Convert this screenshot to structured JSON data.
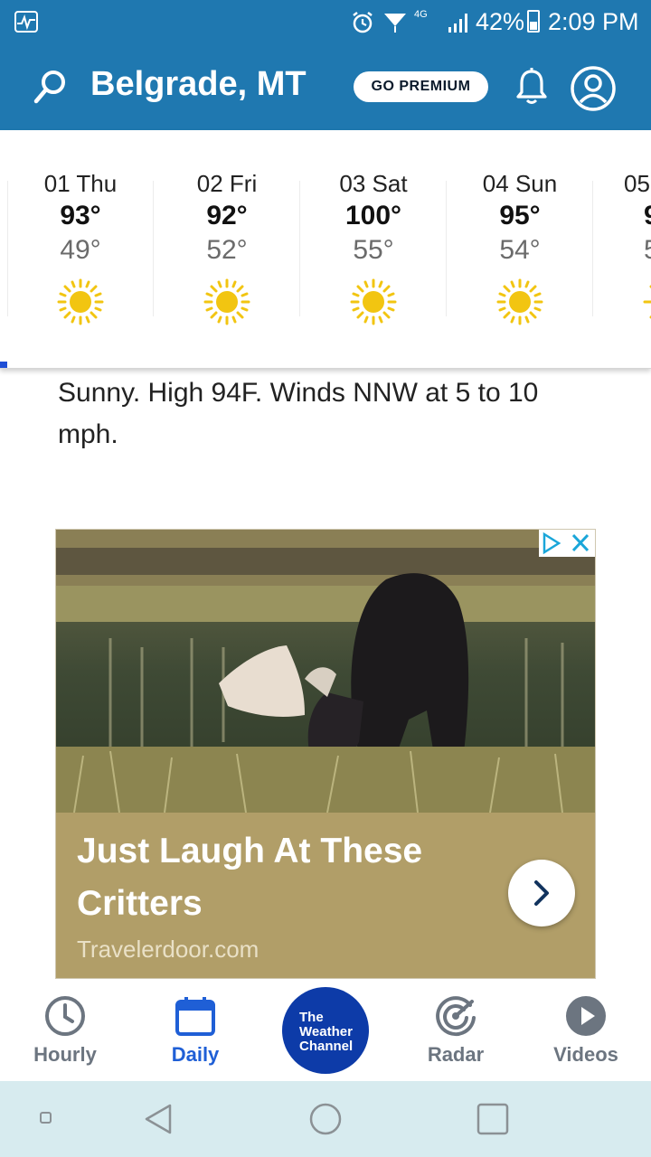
{
  "status_bar": {
    "network": "4G",
    "battery_text": "42%",
    "battery_level": 0.42,
    "time": "2:09 PM"
  },
  "header": {
    "location": "Belgrade, MT",
    "premium_label": "GO PREMIUM"
  },
  "days": [
    {
      "label": "01 Thu",
      "high": "93°",
      "low": "49°",
      "icon": "sunny-icon"
    },
    {
      "label": "02 Fri",
      "high": "92°",
      "low": "52°",
      "icon": "sunny-icon"
    },
    {
      "label": "03 Sat",
      "high": "100°",
      "low": "55°",
      "icon": "sunny-icon"
    },
    {
      "label": "04 Sun",
      "high": "95°",
      "low": "54°",
      "icon": "sunny-icon"
    },
    {
      "label": "05",
      "high": "9",
      "low": "5",
      "icon": "sunny-icon"
    }
  ],
  "forecast_text": "Sunny. High 94F. Winds NNW at 5 to 10 mph.",
  "ad": {
    "headline": "Just Laugh At These Critters",
    "source": "Travelerdoor.com"
  },
  "bottom_nav": {
    "hourly": "Hourly",
    "daily": "Daily",
    "logo_text": "The\nWeather\nChannel",
    "radar": "Radar",
    "videos": "Videos"
  },
  "colors": {
    "header_bg": "#1f78b0",
    "active_tab": "#1f5fd6",
    "sun": "#f2c511",
    "logo_bg": "#0d3ba8",
    "ad_caption_bg": "#b19e68"
  }
}
